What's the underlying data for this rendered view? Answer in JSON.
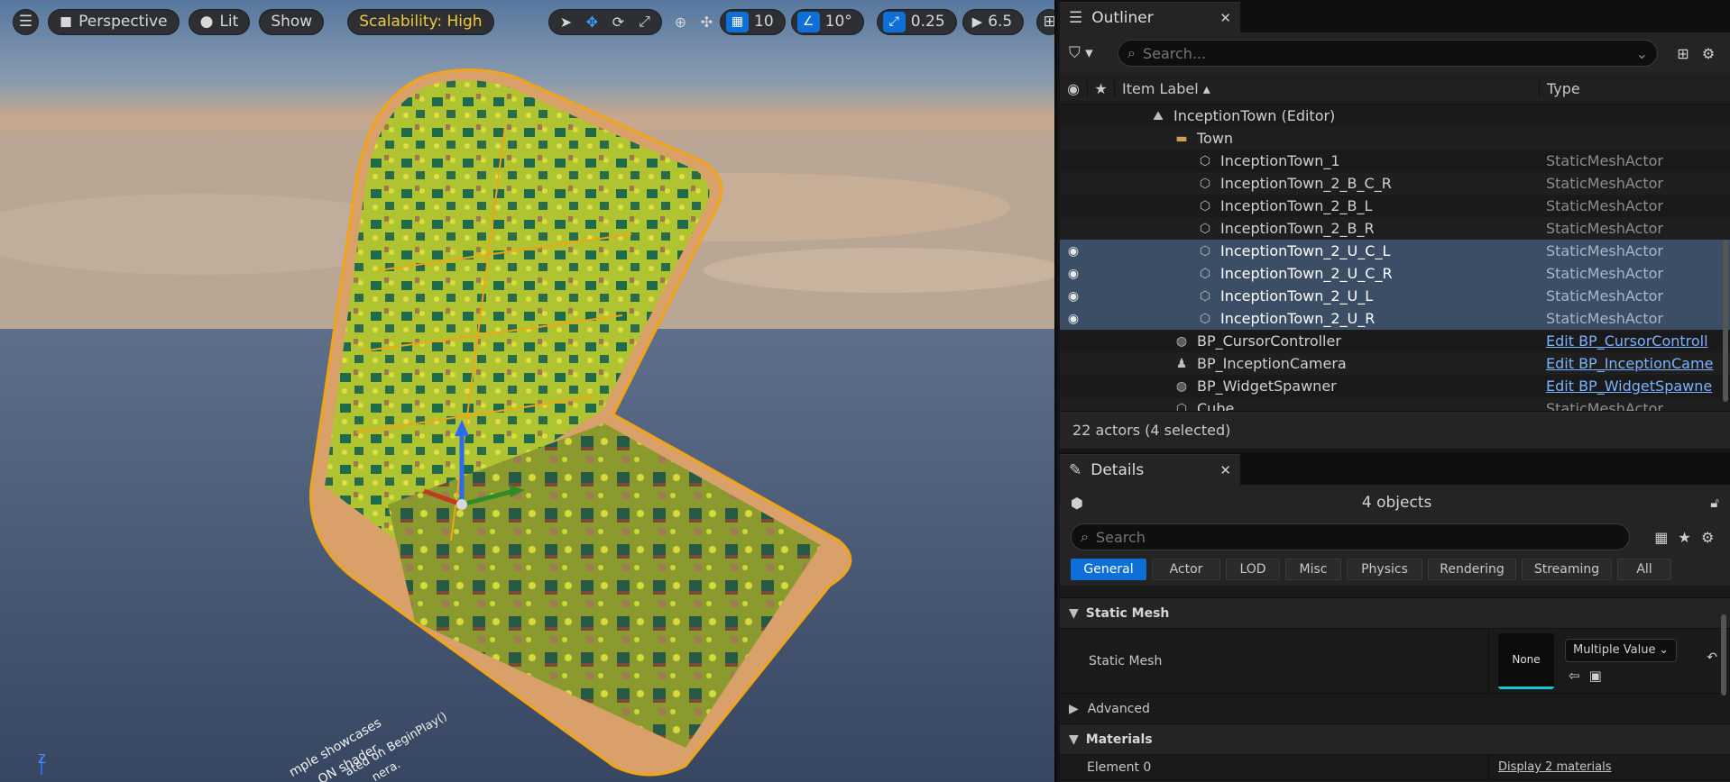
{
  "viewport": {
    "menu_icon": "hamburger-icon",
    "perspective_label": "Perspective",
    "lit_label": "Lit",
    "show_label": "Show",
    "scalability_label": "Scalability: High",
    "grid_snap_value": "10",
    "rotation_snap_value": "10°",
    "scale_snap_value": "0.25",
    "camera_speed_value": "6.5",
    "scene_text_lines": [
      "mple showcases",
      "ON shader.",
      "ated on BeginPlay()",
      "nera."
    ],
    "axis_z_label": "Z"
  },
  "outliner": {
    "tab_title": "Outliner",
    "search_placeholder": "Search...",
    "col_item_label": "Item Label ▴",
    "col_type": "Type",
    "rows": [
      {
        "label": "InceptionTown (Editor)",
        "type": "",
        "indent": 1,
        "icon": "level",
        "selected": false
      },
      {
        "label": "Town",
        "type": "",
        "indent": 2,
        "icon": "folder",
        "selected": false
      },
      {
        "label": "InceptionTown_1",
        "type": "StaticMeshActor",
        "indent": 3,
        "icon": "mesh",
        "selected": false
      },
      {
        "label": "InceptionTown_2_B_C_R",
        "type": "StaticMeshActor",
        "indent": 3,
        "icon": "mesh",
        "selected": false
      },
      {
        "label": "InceptionTown_2_B_L",
        "type": "StaticMeshActor",
        "indent": 3,
        "icon": "mesh",
        "selected": false
      },
      {
        "label": "InceptionTown_2_B_R",
        "type": "StaticMeshActor",
        "indent": 3,
        "icon": "mesh",
        "selected": false
      },
      {
        "label": "InceptionTown_2_U_C_L",
        "type": "StaticMeshActor",
        "indent": 3,
        "icon": "mesh",
        "selected": true
      },
      {
        "label": "InceptionTown_2_U_C_R",
        "type": "StaticMeshActor",
        "indent": 3,
        "icon": "mesh",
        "selected": true
      },
      {
        "label": "InceptionTown_2_U_L",
        "type": "StaticMeshActor",
        "indent": 3,
        "icon": "mesh",
        "selected": true
      },
      {
        "label": "InceptionTown_2_U_R",
        "type": "StaticMeshActor",
        "indent": 3,
        "icon": "mesh",
        "selected": true
      },
      {
        "label": "BP_CursorController",
        "type": "Edit BP_CursorControll",
        "indent": 2,
        "icon": "blueprint",
        "selected": false,
        "link": true
      },
      {
        "label": "BP_InceptionCamera",
        "type": "Edit BP_InceptionCame",
        "indent": 2,
        "icon": "pawn",
        "selected": false,
        "link": true
      },
      {
        "label": "BP_WidgetSpawner",
        "type": "Edit BP_WidgetSpawne",
        "indent": 2,
        "icon": "blueprint",
        "selected": false,
        "link": true
      },
      {
        "label": "Cube",
        "type": "StaticMeshActor",
        "indent": 2,
        "icon": "mesh",
        "selected": false
      }
    ],
    "footer": "22 actors (4 selected)"
  },
  "details": {
    "tab_title": "Details",
    "object_count": "4 objects",
    "search_placeholder": "Search",
    "categories": [
      "General",
      "Actor",
      "LOD",
      "Misc",
      "Physics",
      "Rendering",
      "Streaming",
      "All"
    ],
    "active_category": "General",
    "static_mesh_section": "Static Mesh",
    "static_mesh_prop": "Static Mesh",
    "static_mesh_thumb": "None",
    "static_mesh_value": "Multiple Value",
    "advanced_label": "Advanced",
    "materials_section": "Materials",
    "element0_label": "Element 0",
    "element0_value": "Display 2 materials"
  },
  "colors": {
    "accent_blue": "#0e6fd8",
    "selection": "#3c4e66",
    "scalability_yellow": "#f0c93c",
    "link_blue": "#7bb3ff"
  }
}
